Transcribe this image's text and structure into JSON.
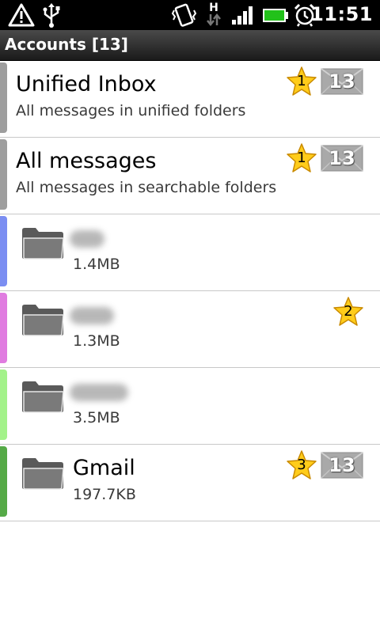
{
  "status_bar": {
    "time": "11:51",
    "network_label": "H",
    "icons": [
      "warning-icon",
      "usb-icon",
      "vibrate-icon",
      "network-h-icon",
      "signal-icon",
      "battery-icon",
      "alarm-icon"
    ]
  },
  "header": {
    "title": "Accounts [13]"
  },
  "accounts": [
    {
      "name": "Unified Inbox",
      "detail": "All messages in unified folders",
      "starred": "1",
      "unread": "13",
      "color": "#9e9e9e"
    },
    {
      "name": "All messages",
      "detail": "All messages in searchable folders",
      "starred": "1",
      "unread": "13",
      "color": "#9e9e9e"
    },
    {
      "name": "",
      "detail": "1.4MB",
      "color": "#7b8ef2"
    },
    {
      "name": "",
      "detail": "1.3MB",
      "starred": "2",
      "color": "#e07ce0"
    },
    {
      "name": "",
      "detail": "3.5MB",
      "color": "#a3f28a"
    },
    {
      "name": "Gmail",
      "detail": "197.7KB",
      "starred": "3",
      "unread": "13",
      "color": "#55aa47"
    }
  ],
  "colors": {
    "star_fill": "#ffcc1a",
    "star_stroke": "#c98a00",
    "envelope": "#a9a9a9"
  }
}
